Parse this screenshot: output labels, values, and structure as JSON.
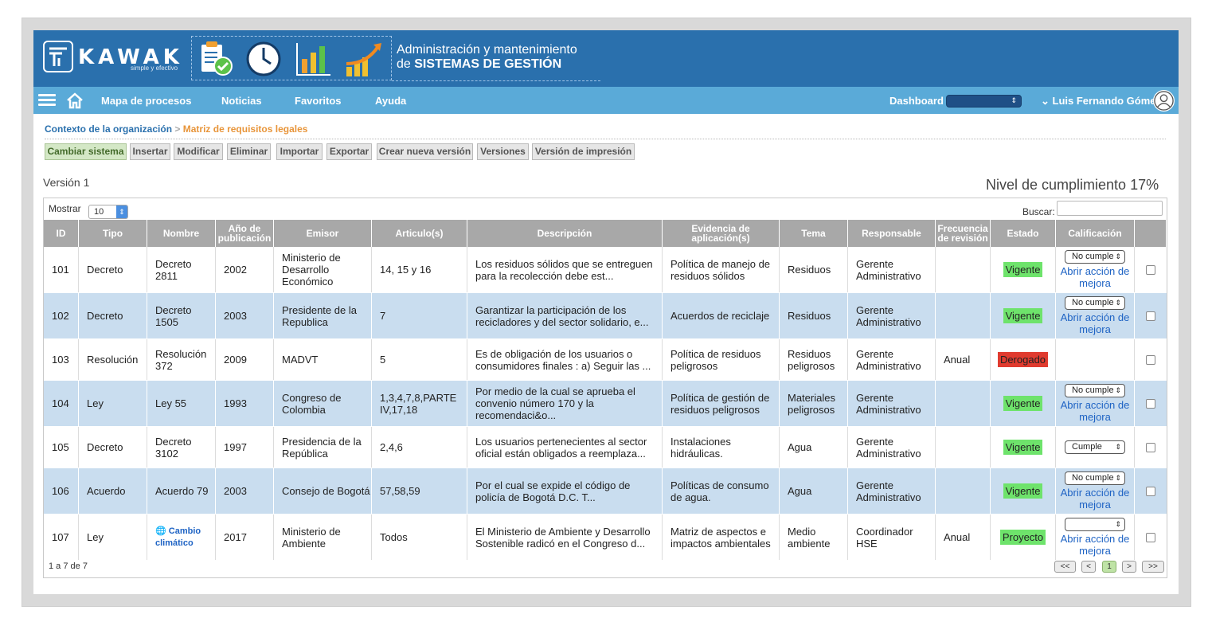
{
  "brand": {
    "name": "KAWAK",
    "tagline": "simple y efectivo"
  },
  "banner": {
    "line1": "Administración y mantenimiento",
    "line2_prefix": "de",
    "line2_bold": "SISTEMAS DE GESTIÓN"
  },
  "nav": {
    "items": [
      "Mapa de procesos",
      "Noticias",
      "Favoritos",
      "Ayuda"
    ],
    "dashboard_label": "Dashboard",
    "user": "Luis Fernando Gómez"
  },
  "breadcrumb": {
    "parent": "Contexto de la organización",
    "separator": ">",
    "current": "Matriz de requisitos legales"
  },
  "toolbar": [
    "Cambiar sistema",
    "Insertar",
    "Modificar",
    "Eliminar",
    "Importar",
    "Exportar",
    "Crear nueva versión",
    "Versiones",
    "Versión de impresión"
  ],
  "version": "Versión 1",
  "compliance": "Nivel de cumplimiento 17%",
  "table": {
    "show_label": "Mostrar",
    "show_value": "10",
    "search_label": "Buscar:",
    "headers": [
      "ID",
      "Tipo",
      "Nombre",
      "Año de publicación",
      "Emisor",
      "Articulo(s)",
      "Descripción",
      "Evidencia de aplicación(s)",
      "Tema",
      "Responsable",
      "Frecuencia de revisión",
      "Estado",
      "Calificación",
      ""
    ],
    "rows": [
      {
        "id": "101",
        "tipo": "Decreto",
        "nombre": "Decreto 2811",
        "anio": "2002",
        "emisor": "Ministerio de Desarrollo Económico",
        "articulos": "14, 15 y 16",
        "descripcion": "Los residuos sólidos que se entreguen para la recolección debe est...",
        "evidencia": "Política de manejo de residuos sólidos",
        "tema": "Residuos",
        "responsable": "Gerente Administrativo",
        "frecuencia": "",
        "estado": "Vigente",
        "calificacion": "No cumple",
        "accion": "Abrir acción de mejora"
      },
      {
        "id": "102",
        "tipo": "Decreto",
        "nombre": "Decreto 1505",
        "anio": "2003",
        "emisor": "Presidente de la Republica",
        "articulos": "7",
        "descripcion": "Garantizar la participación de los recicladores y del sector solidario, e...",
        "evidencia": "Acuerdos de reciclaje",
        "tema": "Residuos",
        "responsable": "Gerente Administrativo",
        "frecuencia": "",
        "estado": "Vigente",
        "calificacion": "No cumple",
        "accion": "Abrir acción de mejora"
      },
      {
        "id": "103",
        "tipo": "Resolución",
        "nombre": "Resolución 372",
        "anio": "2009",
        "emisor": "MADVT",
        "articulos": "5",
        "descripcion": "Es de obligación de los usuarios o consumidores finales : a) Seguir las ...",
        "evidencia": "Política de residuos peligrosos",
        "tema": "Residuos peligrosos",
        "responsable": "Gerente Administrativo",
        "frecuencia": "Anual",
        "estado": "Derogado",
        "calificacion": "",
        "accion": ""
      },
      {
        "id": "104",
        "tipo": "Ley",
        "nombre": "Ley 55",
        "anio": "1993",
        "emisor": "Congreso de Colombia",
        "articulos": "1,3,4,7,8,PARTE IV,17,18",
        "descripcion": "Por medio de la cual se aprueba el convenio número 170 y la recomendaci&o...",
        "evidencia": "Política de gestión de residuos peligrosos",
        "tema": "Materiales peligrosos",
        "responsable": "Gerente Administrativo",
        "frecuencia": "",
        "estado": "Vigente",
        "calificacion": "No cumple",
        "accion": "Abrir acción de mejora"
      },
      {
        "id": "105",
        "tipo": "Decreto",
        "nombre": "Decreto 3102",
        "anio": "1997",
        "emisor": "Presidencia de la República",
        "articulos": "2,4,6",
        "descripcion": "Los usuarios pertenecientes al sector oficial están obligados a reemplaza...",
        "evidencia": "Instalaciones hidráulicas.",
        "tema": "Agua",
        "responsable": "Gerente Administrativo",
        "frecuencia": "",
        "estado": "Vigente",
        "calificacion": "Cumple",
        "accion": ""
      },
      {
        "id": "106",
        "tipo": "Acuerdo",
        "nombre": "Acuerdo 79",
        "anio": "2003",
        "emisor": "Consejo de Bogotá",
        "articulos": "57,58,59",
        "descripcion": "Por el cual se expide el código de policía de Bogotá D.C. T...",
        "evidencia": "Políticas de consumo de agua.",
        "tema": "Agua",
        "responsable": "Gerente Administrativo",
        "frecuencia": "",
        "estado": "Vigente",
        "calificacion": "No cumple",
        "accion": "Abrir acción de mejora"
      },
      {
        "id": "107",
        "tipo": "Ley",
        "nombre": "Cambio climático",
        "anio": "2017",
        "emisor": "Ministerio de Ambiente",
        "articulos": "Todos",
        "descripcion": "El Ministerio de Ambiente y Desarrollo Sostenible radicó en el Congreso d...",
        "evidencia": "Matriz de aspectos e impactos ambientales",
        "tema": "Medio ambiente",
        "responsable": "Coordinador HSE",
        "frecuencia": "Anual",
        "estado": "Proyecto",
        "calificacion": "blank",
        "accion": "Abrir acción de mejora"
      }
    ],
    "footer_info": "1 a 7 de 7",
    "pager": [
      "<<",
      "<",
      "1",
      ">",
      ">>"
    ]
  },
  "colors": {
    "banner": "#2a70ad",
    "navbar": "#5aaad8",
    "row_alt": "#c9ddef",
    "header": "#a8a8a8",
    "status_green": "#6ee36b",
    "status_red": "#e03b2f"
  }
}
